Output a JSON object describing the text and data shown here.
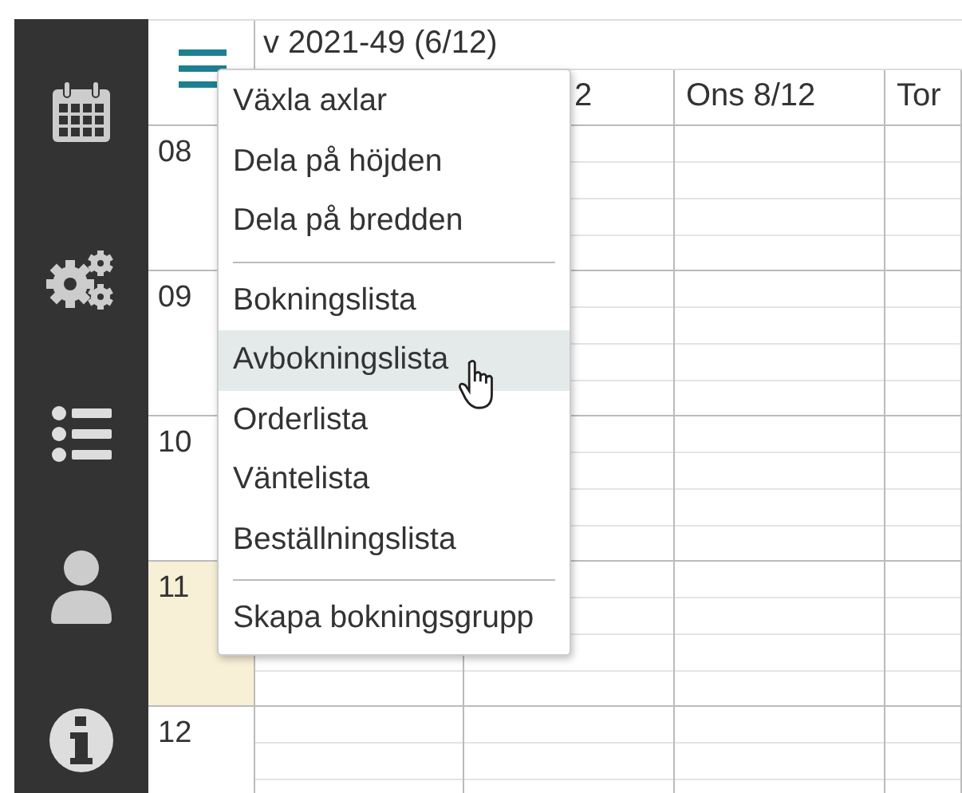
{
  "sidebar": {
    "items": [
      {
        "kind": "calendar"
      },
      {
        "kind": "gears"
      },
      {
        "kind": "list"
      },
      {
        "kind": "user"
      },
      {
        "kind": "info"
      }
    ]
  },
  "calendar": {
    "week": "v 2021-49 (6/12)",
    "columns": [
      {},
      {
        "label": "2"
      },
      {
        "label": "Ons 8/12"
      },
      {
        "label": "Tor"
      }
    ],
    "hours": [
      {
        "label": "08",
        "highlighted": false
      },
      {
        "label": "09",
        "highlighted": false
      },
      {
        "label": "10",
        "highlighted": false
      },
      {
        "label": "11",
        "highlighted": true
      },
      {
        "label": "12",
        "highlighted": false
      }
    ]
  },
  "menu": {
    "items": [
      {
        "kind": "item",
        "label": "Växla axlar",
        "selected": false
      },
      {
        "kind": "item",
        "label": "Dela på höjden",
        "selected": false
      },
      {
        "kind": "item",
        "label": "Dela på bredden",
        "selected": false
      },
      {
        "kind": "separator"
      },
      {
        "kind": "item",
        "label": "Bokningslista",
        "selected": false
      },
      {
        "kind": "item",
        "label": "Avbokningslista",
        "selected": true
      },
      {
        "kind": "item",
        "label": "Orderlista",
        "selected": false
      },
      {
        "kind": "item",
        "label": "Väntelista",
        "selected": false
      },
      {
        "kind": "item",
        "label": "Beställningslista",
        "selected": false
      },
      {
        "kind": "separator"
      },
      {
        "kind": "item",
        "label": "Skapa bokningsgrupp",
        "selected": false
      }
    ]
  }
}
